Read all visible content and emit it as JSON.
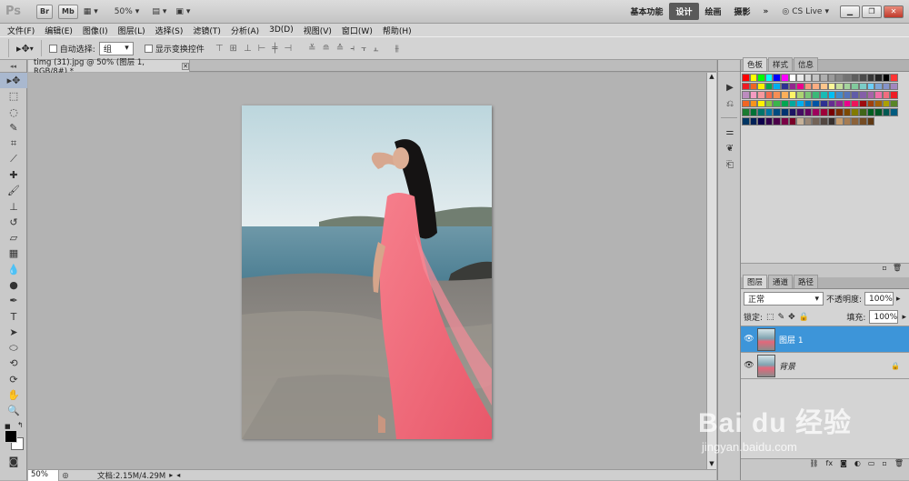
{
  "app": {
    "logo": "Ps",
    "bridge_btn": "Br",
    "minibridge_btn": "Mb",
    "zoom": "50%",
    "workspaces": [
      "基本功能",
      "设计",
      "绘画",
      "摄影"
    ],
    "active_workspace": "设计",
    "more": "»",
    "cs_live": "CS Live"
  },
  "menu": [
    "文件(F)",
    "编辑(E)",
    "图像(I)",
    "图层(L)",
    "选择(S)",
    "滤镜(T)",
    "分析(A)",
    "3D(D)",
    "视图(V)",
    "窗口(W)",
    "帮助(H)"
  ],
  "options": {
    "auto_select_label": "自动选择:",
    "auto_select_value": "组",
    "show_transform_label": "显示变换控件"
  },
  "document": {
    "tab_title": "timg (31).jpg @ 50% (图层 1, RGB/8#) *",
    "zoom_status": "50%",
    "doc_info": "文档:2.15M/4.29M"
  },
  "swatches_panel": {
    "tabs": [
      "色板",
      "样式",
      "信息"
    ],
    "active_tab": "色板"
  },
  "layers_panel": {
    "tabs": [
      "图层",
      "通道",
      "路径"
    ],
    "active_tab": "图层",
    "blend_mode": "正常",
    "opacity_label": "不透明度:",
    "opacity_value": "100%",
    "lock_label": "锁定:",
    "fill_label": "填充:",
    "fill_value": "100%",
    "layers": [
      {
        "name": "图层 1",
        "selected": true,
        "locked": false
      },
      {
        "name": "背景",
        "selected": false,
        "locked": true
      }
    ]
  },
  "watermark": {
    "brand": "Bai du 经验",
    "url": "jingyan.baidu.com"
  },
  "colors": {
    "selection_blue": "#3d95d9",
    "dress": "#ef6b7b",
    "sky": "#cfe1e6",
    "sea": "#5b8ea3"
  }
}
